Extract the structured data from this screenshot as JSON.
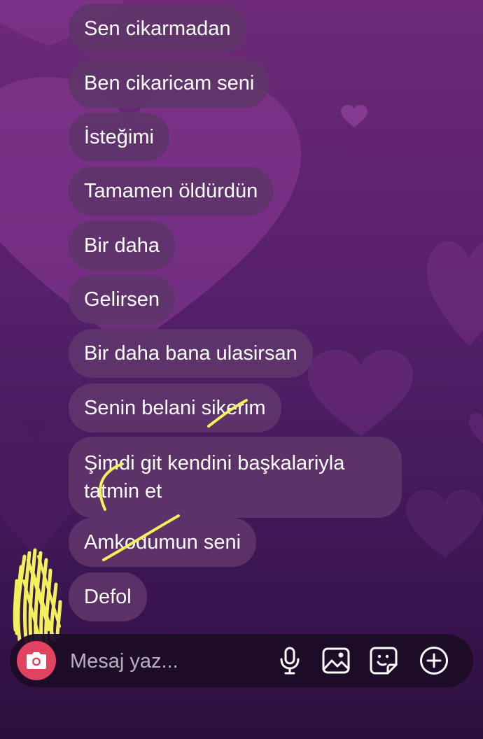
{
  "messages": [
    {
      "text": "Sen cikarmadan"
    },
    {
      "text": "Ben cikaricam seni"
    },
    {
      "text": "İsteğimi"
    },
    {
      "text": "Tamamen öldürdün"
    },
    {
      "text": "Bir daha"
    },
    {
      "text": "Gelirsen"
    },
    {
      "text": "Bir daha bana ulasirsan"
    },
    {
      "text": "Senin belani sikerim"
    },
    {
      "text": "Şimdi git kendini başkalariyla tatmin et"
    },
    {
      "text": "Amkodumun seni"
    },
    {
      "text": "Defol"
    }
  ],
  "composer": {
    "placeholder": "Mesaj yaz...",
    "camera_icon": "camera-icon",
    "mic_icon": "microphone-icon",
    "gallery_icon": "image-icon",
    "sticker_icon": "sticker-icon",
    "add_icon": "plus-circle-icon"
  },
  "colors": {
    "bubble": "#60346a",
    "camera_button": "#e0435f",
    "scribble": "#f3f05a",
    "composer_background": "#1e0c26"
  }
}
